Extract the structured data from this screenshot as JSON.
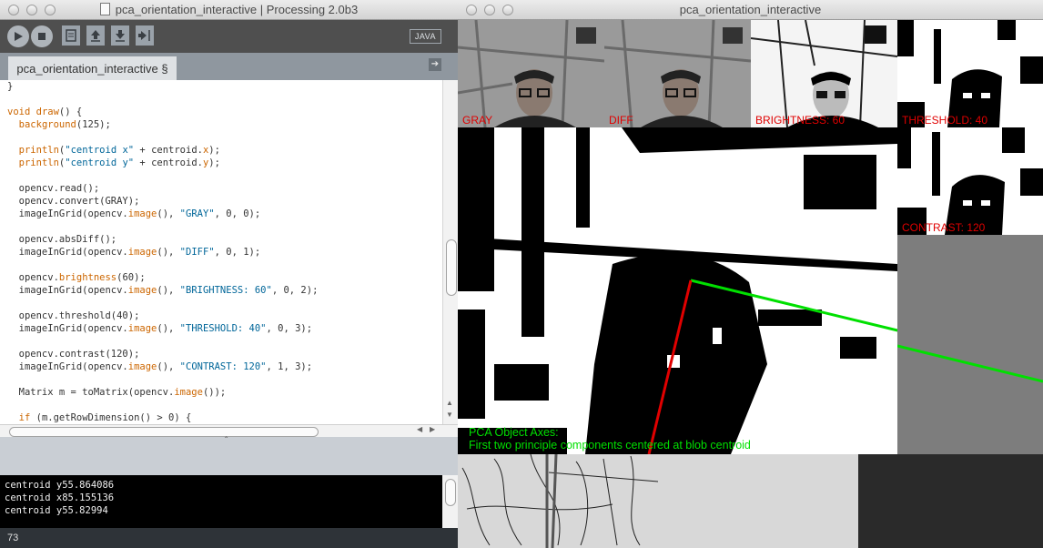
{
  "editor": {
    "title": "pca_orientation_interactive | Processing 2.0b3",
    "mode": "JAVA",
    "tab": "pca_orientation_interactive §",
    "code_lines": [
      [
        {
          "t": "}"
        }
      ],
      [],
      [
        {
          "t": "void",
          "c": "kw"
        },
        {
          "t": " "
        },
        {
          "t": "draw",
          "c": "fn"
        },
        {
          "t": "() {"
        }
      ],
      [
        {
          "t": "  "
        },
        {
          "t": "background",
          "c": "fn"
        },
        {
          "t": "(125);"
        }
      ],
      [],
      [
        {
          "t": "  "
        },
        {
          "t": "println",
          "c": "fn"
        },
        {
          "t": "("
        },
        {
          "t": "\"centroid x\"",
          "c": "str"
        },
        {
          "t": " + centroid."
        },
        {
          "t": "x",
          "c": "fn"
        },
        {
          "t": ");"
        }
      ],
      [
        {
          "t": "  "
        },
        {
          "t": "println",
          "c": "fn"
        },
        {
          "t": "("
        },
        {
          "t": "\"centroid y\"",
          "c": "str"
        },
        {
          "t": " + centroid."
        },
        {
          "t": "y",
          "c": "fn"
        },
        {
          "t": ");"
        }
      ],
      [],
      [
        {
          "t": "  opencv.read();"
        }
      ],
      [
        {
          "t": "  opencv.convert(GRAY);"
        }
      ],
      [
        {
          "t": "  imageInGrid(opencv."
        },
        {
          "t": "image",
          "c": "fn"
        },
        {
          "t": "(), "
        },
        {
          "t": "\"GRAY\"",
          "c": "str"
        },
        {
          "t": ", 0, 0);"
        }
      ],
      [],
      [
        {
          "t": "  opencv.absDiff();"
        }
      ],
      [
        {
          "t": "  imageInGrid(opencv."
        },
        {
          "t": "image",
          "c": "fn"
        },
        {
          "t": "(), "
        },
        {
          "t": "\"DIFF\"",
          "c": "str"
        },
        {
          "t": ", 0, 1);"
        }
      ],
      [],
      [
        {
          "t": "  opencv."
        },
        {
          "t": "brightness",
          "c": "fn"
        },
        {
          "t": "(60);"
        }
      ],
      [
        {
          "t": "  imageInGrid(opencv."
        },
        {
          "t": "image",
          "c": "fn"
        },
        {
          "t": "(), "
        },
        {
          "t": "\"BRIGHTNESS: 60\"",
          "c": "str"
        },
        {
          "t": ", 0, 2);"
        }
      ],
      [],
      [
        {
          "t": "  opencv.threshold(40);"
        }
      ],
      [
        {
          "t": "  imageInGrid(opencv."
        },
        {
          "t": "image",
          "c": "fn"
        },
        {
          "t": "(), "
        },
        {
          "t": "\"THRESHOLD: 40\"",
          "c": "str"
        },
        {
          "t": ", 0, 3);"
        }
      ],
      [],
      [
        {
          "t": "  opencv.contrast(120);"
        }
      ],
      [
        {
          "t": "  imageInGrid(opencv."
        },
        {
          "t": "image",
          "c": "fn"
        },
        {
          "t": "(), "
        },
        {
          "t": "\"CONTRAST: 120\"",
          "c": "str"
        },
        {
          "t": ", 1, 3);"
        }
      ],
      [],
      [
        {
          "t": "  Matrix m = toMatrix(opencv."
        },
        {
          "t": "image",
          "c": "fn"
        },
        {
          "t": "());"
        }
      ],
      [],
      [
        {
          "t": "  "
        },
        {
          "t": "if",
          "c": "kw"
        },
        {
          "t": " (m.getRowDimension() > 0) {"
        }
      ]
    ],
    "console_lines": [
      "centroid y55.864086",
      "centroid x85.155136",
      "centroid y55.82994"
    ],
    "status_line": "73"
  },
  "sketch": {
    "title": "pca_orientation_interactive",
    "labels": {
      "gray": "GRAY",
      "diff": "DIFF",
      "brightness": "BRIGHTNESS: 60",
      "threshold": "THRESHOLD: 40",
      "contrast": "CONTRAST: 120"
    },
    "pca_title": "PCA Object Axes:",
    "pca_subtitle": "First two principle components centered at blob centroid",
    "colors": {
      "label": "#e00000",
      "pca_text": "#00e000",
      "axis1": "#00e000",
      "axis2": "#e00000",
      "background": "#7d7d7d"
    }
  }
}
